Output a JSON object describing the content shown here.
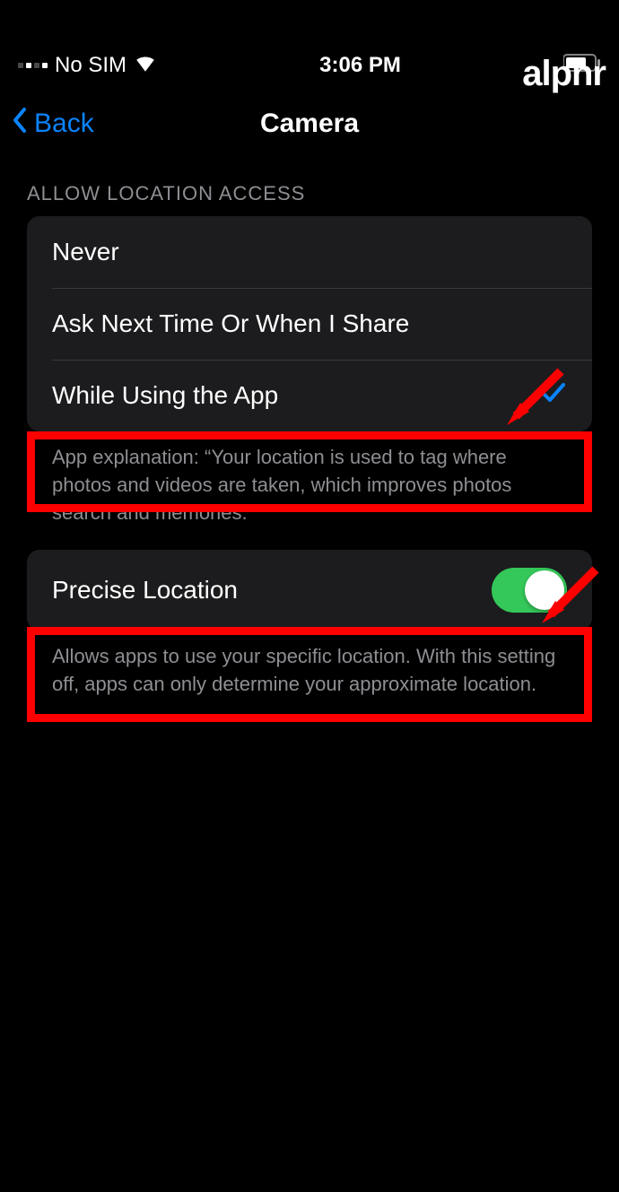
{
  "watermark": "alphr",
  "status": {
    "carrier": "No SIM",
    "time": "3:06 PM"
  },
  "nav": {
    "back_label": "Back",
    "title": "Camera"
  },
  "section1": {
    "header": "ALLOW LOCATION ACCESS",
    "options": {
      "never": "Never",
      "ask": "Ask Next Time Or When I Share",
      "while_using": "While Using the App"
    },
    "footer": "App explanation: “Your location is used to tag where photos and videos are taken, which improves photos search and memories.”"
  },
  "section2": {
    "precise_label": "Precise Location",
    "footer": "Allows apps to use your specific location. With this setting off, apps can only determine your approximate location."
  }
}
